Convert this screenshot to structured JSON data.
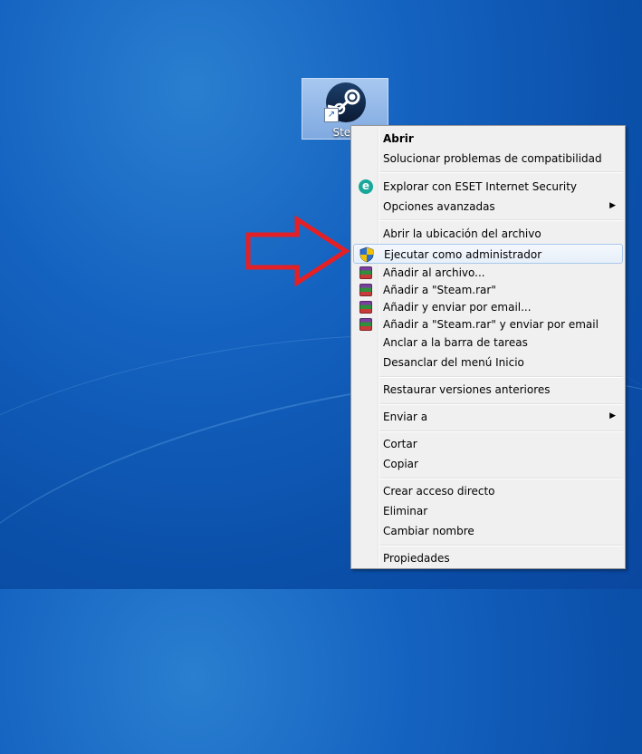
{
  "desktop": {
    "icon_label": "Stea"
  },
  "context_menu": {
    "items": [
      {
        "label": "Abrir",
        "bold": true,
        "icon": ""
      },
      {
        "label": "Solucionar problemas de compatibilidad",
        "icon": ""
      },
      {
        "label": "Explorar con ESET Internet Security",
        "icon": "eset-icon"
      },
      {
        "label": "Opciones avanzadas",
        "icon": "",
        "submenu": true
      },
      {
        "label": "Abrir la ubicación del archivo",
        "icon": ""
      },
      {
        "label": "Ejecutar como administrador",
        "icon": "uac-shield-icon",
        "highlighted": true
      },
      {
        "label": "Añadir al archivo...",
        "icon": "winrar-icon"
      },
      {
        "label": "Añadir a \"Steam.rar\"",
        "icon": "winrar-icon"
      },
      {
        "label": "Añadir y enviar por email...",
        "icon": "winrar-icon"
      },
      {
        "label": "Añadir a \"Steam.rar\" y enviar por email",
        "icon": "winrar-icon"
      },
      {
        "label": "Anclar a la barra de tareas",
        "icon": ""
      },
      {
        "label": "Desanclar del menú Inicio",
        "icon": ""
      },
      {
        "label": "Restaurar versiones anteriores",
        "icon": ""
      },
      {
        "label": "Enviar a",
        "icon": "",
        "submenu": true
      },
      {
        "label": "Cortar",
        "icon": ""
      },
      {
        "label": "Copiar",
        "icon": ""
      },
      {
        "label": "Crear acceso directo",
        "icon": ""
      },
      {
        "label": "Eliminar",
        "icon": ""
      },
      {
        "label": "Cambiar nombre",
        "icon": ""
      },
      {
        "label": "Propiedades",
        "icon": ""
      }
    ],
    "submenu_glyph": "▶",
    "eset_glyph": "e",
    "shortcut_glyph": "↗"
  },
  "colors": {
    "arrow_red": "#e32026",
    "highlight_border": "#a8c8ec"
  }
}
